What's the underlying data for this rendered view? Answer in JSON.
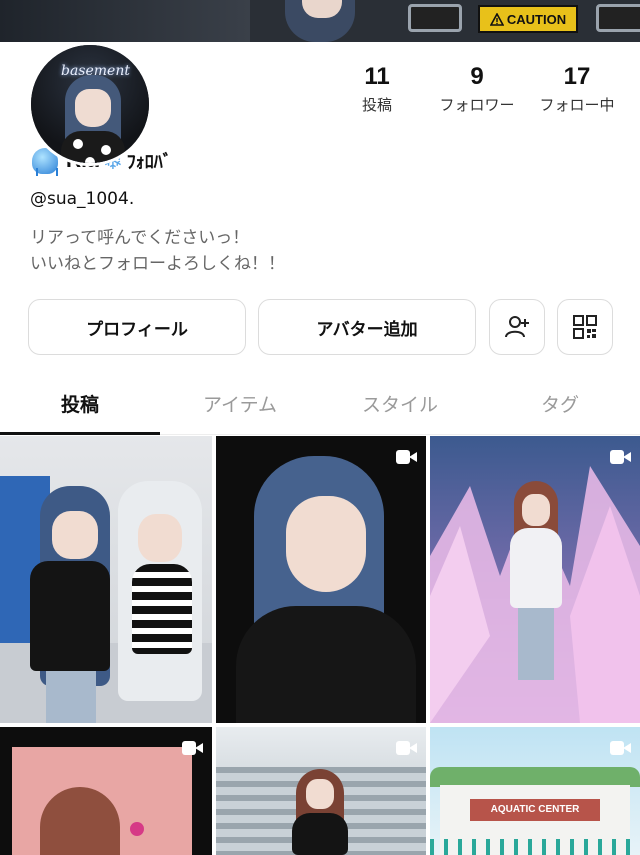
{
  "cover": {
    "caution_text": "CAUTION",
    "caution_icon": "warning-triangle-icon"
  },
  "avatar": {
    "neon_text": "basement"
  },
  "profile": {
    "name": "Ria",
    "name_suffix": "ﾌｫﾛﾊﾞ",
    "handle": "@sua_1004.",
    "bio_line1": "リアって呼んでくださいっ！",
    "bio_line2": "いいねとフォローよろしくね！！"
  },
  "stats": [
    {
      "value": "11",
      "label": "投稿"
    },
    {
      "value": "9",
      "label": "フォロワー"
    },
    {
      "value": "17",
      "label": "フォロー中"
    }
  ],
  "buttons": {
    "profile": "プロフィール",
    "add_avatar": "アバター追加",
    "add_friend_icon": "add-person-icon",
    "qr_icon": "qr-code-icon"
  },
  "tabs": [
    {
      "label": "投稿",
      "active": true
    },
    {
      "label": "アイテム",
      "active": false
    },
    {
      "label": "スタイル",
      "active": false
    },
    {
      "label": "タグ",
      "active": false
    }
  ],
  "grid": {
    "tiles": [
      {
        "kind": "image",
        "video": false
      },
      {
        "kind": "video",
        "video": true
      },
      {
        "kind": "video",
        "video": true
      },
      {
        "kind": "video",
        "video": true
      },
      {
        "kind": "video",
        "video": true
      },
      {
        "kind": "video",
        "video": true
      }
    ],
    "pool_sign": "AQUATIC CENTER"
  }
}
